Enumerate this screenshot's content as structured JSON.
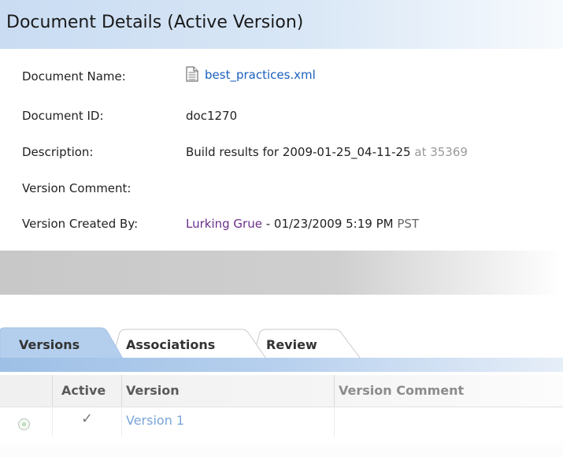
{
  "panel": {
    "title": "Document Details (Active Version)"
  },
  "details": {
    "document_name": {
      "label": "Document Name:",
      "value": "best_practices.xml",
      "icon": "document-icon"
    },
    "document_id": {
      "label": "Document ID:",
      "value": "doc1270"
    },
    "description": {
      "label": "Description:",
      "value_main": "Build results for 2009-01-25_04-11-25",
      "value_suffix": "at 35369"
    },
    "version_comment": {
      "label": "Version Comment:",
      "value": ""
    },
    "version_created_by": {
      "label": "Version Created By:",
      "user": "Lurking Grue",
      "date": "- 01/23/2009 5:19 PM",
      "tz": "PST"
    }
  },
  "tabs": [
    "Versions",
    "Associations",
    "Review"
  ],
  "grid": {
    "columns": [
      "Active",
      "Version",
      "Version Comment"
    ],
    "rows": [
      {
        "selected": true,
        "active_mark": "✓",
        "version": "Version 1",
        "comment": ""
      }
    ]
  },
  "colors": {
    "header_blue": "#c9dcf2",
    "tab_blue": "#9ec0e6",
    "link_blue": "#1a5fbf",
    "user_purple": "#6b2f8a"
  }
}
